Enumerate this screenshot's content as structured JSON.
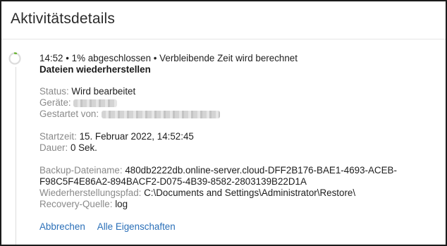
{
  "title": "Aktivitätsdetails",
  "summary": "14:52 • 1% abgeschlossen • Verbleibende Zeit wird berechnet",
  "progress_percent": 1,
  "operation": "Dateien wiederherstellen",
  "status": {
    "label": "Status:",
    "value": "Wird bearbeitet"
  },
  "devices": {
    "label": "Geräte:"
  },
  "started_by": {
    "label": "Gestartet von:"
  },
  "start_time": {
    "label": "Startzeit:",
    "value": "15. Februar 2022, 14:52:45"
  },
  "duration": {
    "label": "Dauer:",
    "value": "0 Sek."
  },
  "backup_filename": {
    "label": "Backup-Dateiname:",
    "value_line1": "480db2222db.online-server.cloud-DFF2B176-BAE1-4693-ACEB-",
    "value_line2": "F98C5F4E86A2-894BACF2-D075-4B39-8582-2803139B22D1A"
  },
  "restore_path": {
    "label": "Wiederherstellungspfad:",
    "value": "C:\\Documents and Settings\\Administrator\\Restore\\"
  },
  "recovery_source": {
    "label": "Recovery-Quelle:",
    "value": "log"
  },
  "actions": {
    "cancel": "Abbrechen",
    "all_properties": "Alle Eigenschaften"
  },
  "colors": {
    "link": "#2a6fb8",
    "progress_accent": "#66b22e",
    "ring": "#dcdcdc",
    "label": "#8a8a8a"
  }
}
